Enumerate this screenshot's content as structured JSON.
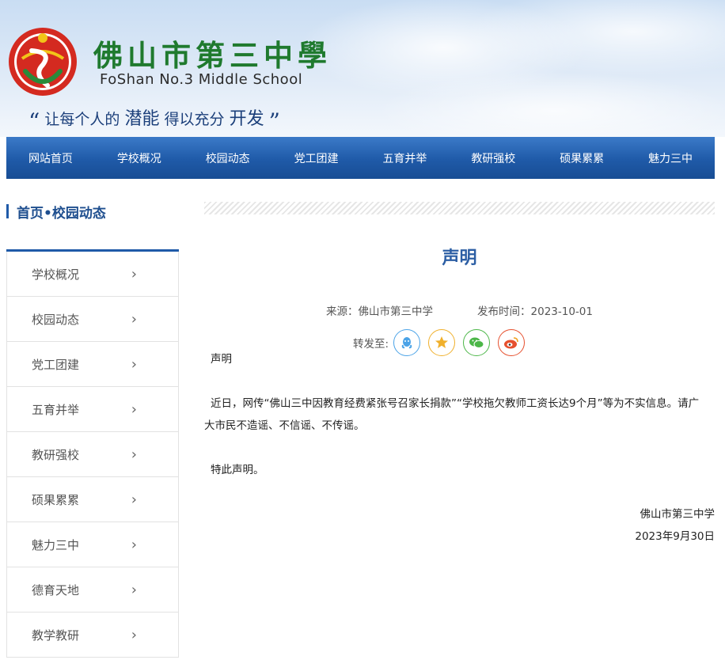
{
  "header": {
    "school_name_cn": "佛山市第三中學",
    "school_name_en": "FoShan No.3 Middle School",
    "motto_open": "“",
    "motto_a": "让每个人的",
    "motto_b": "潜能",
    "motto_c": "得以充分",
    "motto_d": "开发",
    "motto_close": "”"
  },
  "nav": [
    "网站首页",
    "学校概况",
    "校园动态",
    "党工团建",
    "五育并举",
    "教研强校",
    "硕果累累",
    "魅力三中"
  ],
  "breadcrumb": "首页•校园动态",
  "sidebar": [
    {
      "label": "学校概况"
    },
    {
      "label": "校园动态"
    },
    {
      "label": "党工团建"
    },
    {
      "label": "五育并举"
    },
    {
      "label": "教研强校"
    },
    {
      "label": "硕果累累"
    },
    {
      "label": "魅力三中"
    },
    {
      "label": "德育天地"
    },
    {
      "label": "教学教研"
    }
  ],
  "sidebar_chevron": "›",
  "article": {
    "title": "声明",
    "source": "来源：佛山市第三中学",
    "date": "发布时间：2023-10-01",
    "share_label": "转发至:",
    "heading": "声明",
    "paragraph": "近日，网传“佛山三中因教育经费紧张号召家长捐款”“学校拖欠教师工资长达9个月”等为不实信息。请广大市民不造谣、不信谣、不传谣。",
    "closing": "特此声明。",
    "signature": "佛山市第三中学",
    "sign_date": "2023年9月30日"
  },
  "share_icons": [
    "qq-icon",
    "qzone-icon",
    "wechat-icon",
    "weibo-icon"
  ],
  "colors": {
    "nav": "#1f5aa8",
    "title": "#2c5ea4",
    "school_name": "#1f7a2e"
  }
}
